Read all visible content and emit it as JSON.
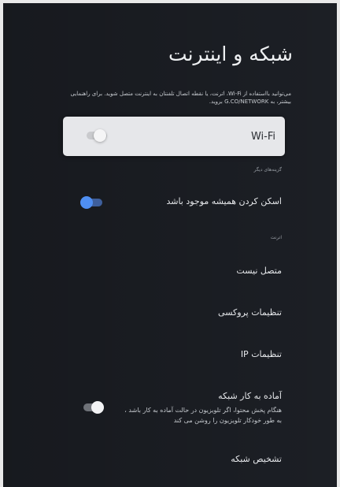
{
  "page": {
    "title": "شبکه و اینترنت",
    "description": "می‌توانید بااستفاده از Wi-Fi، اترنت، یا نقطه اتصال تلفنتان به اینترنت متصل شوید. برای راهنمایی بیشتر، به G.CO/NETWORK بروید."
  },
  "wifi": {
    "label": "Wi-Fi",
    "enabled": false
  },
  "other_options": {
    "header": "گزینه‌های دیگر",
    "always_scan": {
      "label": "اسکن کردن همیشه موجود باشد",
      "enabled": true
    }
  },
  "ethernet": {
    "header": "اترنت",
    "status": "متصل نیست",
    "proxy": "تنظیمات پروکسی",
    "ip": "تنظیمات IP"
  },
  "network_ready": {
    "title": "آماده به کار شبکه",
    "description": "هنگام پخش محتوا، اگر تلویزیون در حالت آماده به کار باشد ، به طور خودکار تلویزیون را روشن می کند",
    "enabled": true
  },
  "diagnostics": {
    "label": "تشخیص شبکه"
  },
  "colors": {
    "background": "#1c1f25",
    "card": "#e6e7ea",
    "accent": "#4f8ff2"
  }
}
